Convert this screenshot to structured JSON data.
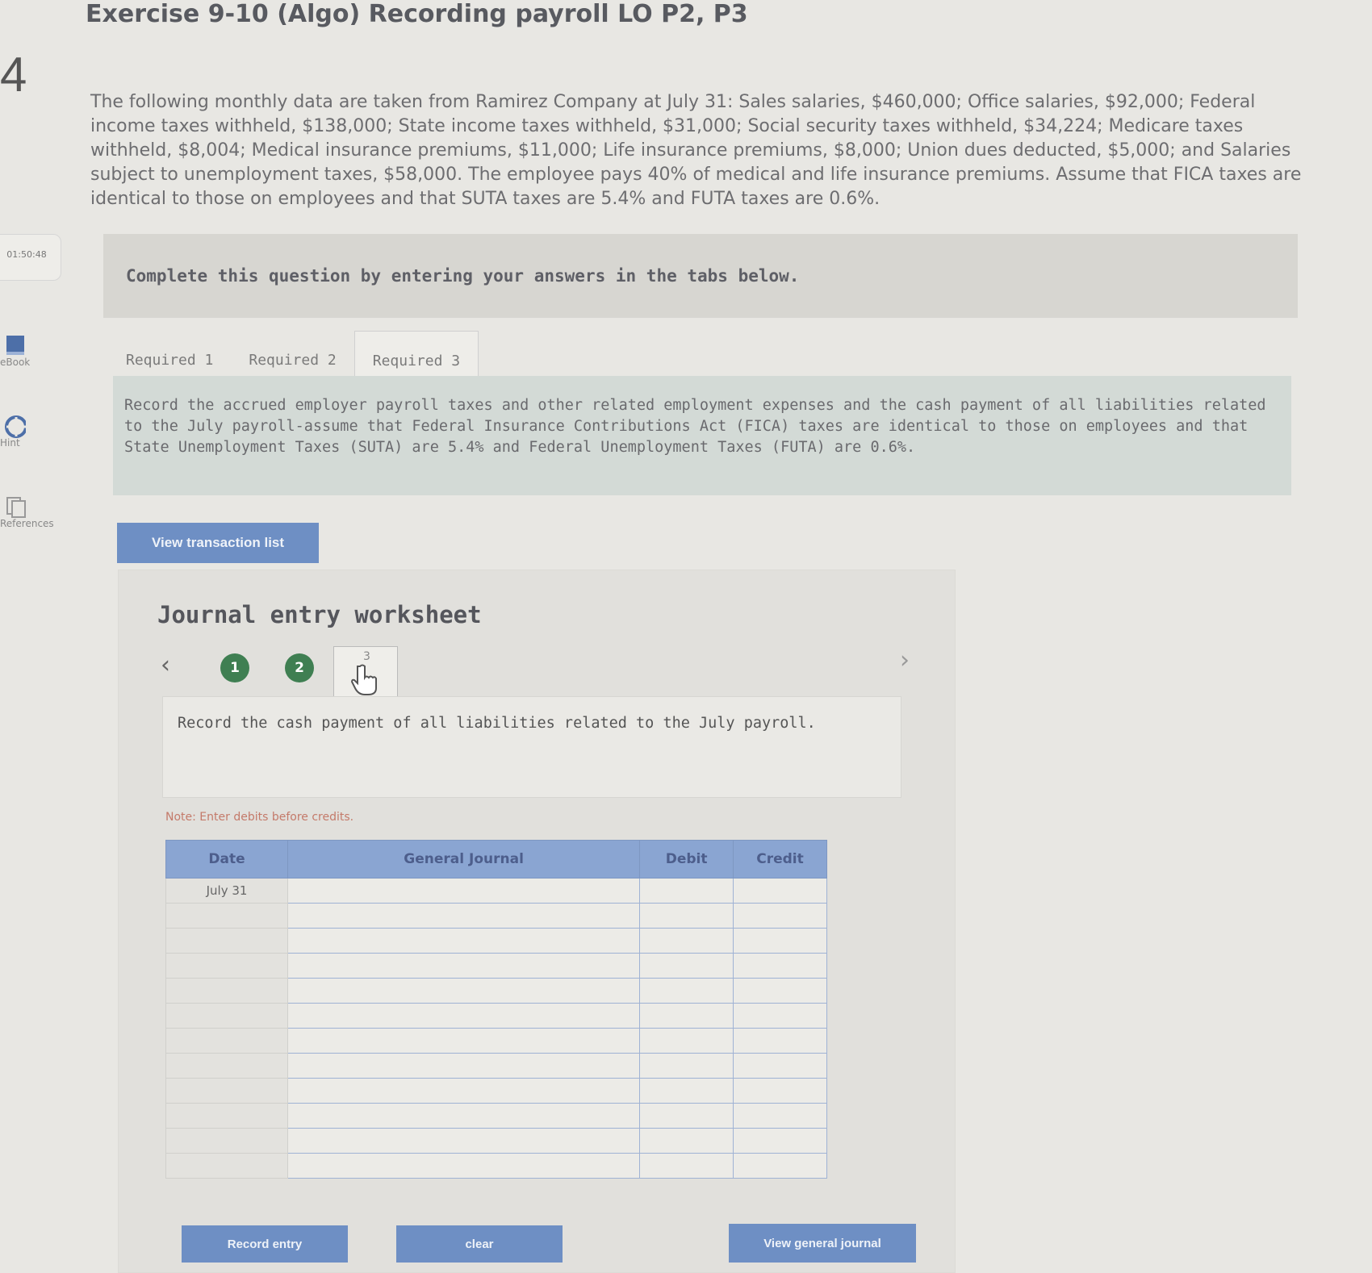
{
  "header": {
    "title": "Exercise 9-10 (Algo) Recording payroll LO P2, P3",
    "question_number": "4"
  },
  "problem_text": "The following monthly data are taken from Ramirez Company at July 31: Sales salaries, $460,000; Office salaries, $92,000; Federal income taxes withheld, $138,000; State income taxes withheld, $31,000; Social security taxes withheld, $34,224; Medicare taxes withheld, $8,004; Medical insurance premiums, $11,000; Life insurance premiums, $8,000; Union dues deducted, $5,000; and Salaries subject to unemployment taxes, $58,000. The employee pays 40% of medical and life insurance premiums. Assume that FICA taxes are identical to those on employees and that SUTA taxes are 5.4% and FUTA taxes are 0.6%.",
  "sidebar": {
    "timer": "01:50:48",
    "items": [
      {
        "label": "eBook"
      },
      {
        "label": "Hint"
      },
      {
        "label": "References"
      }
    ]
  },
  "banner": "Complete this question by entering your answers in the tabs below.",
  "tabs": [
    {
      "label": "Required 1"
    },
    {
      "label": "Required 2"
    },
    {
      "label": "Required 3"
    }
  ],
  "instructions": "Record the accrued employer payroll taxes and other related employment expenses and the cash payment of all liabilities related to the July payroll-assume that Federal Insurance Contributions Act (FICA) taxes are identical to those on employees and that State Unemployment Taxes (SUTA) are 5.4% and Federal Unemployment Taxes (FUTA) are 0.6%.",
  "view_transaction_button": "View transaction list",
  "worksheet": {
    "title": "Journal entry worksheet",
    "steps": [
      "1",
      "2",
      "3"
    ],
    "description": "Record the cash payment of all liabilities related to the July payroll.",
    "note": "Note: Enter debits before credits.",
    "columns": [
      "Date",
      "General Journal",
      "Debit",
      "Credit"
    ],
    "rows": [
      {
        "date": "July 31"
      },
      {
        "date": ""
      },
      {
        "date": ""
      },
      {
        "date": ""
      },
      {
        "date": ""
      },
      {
        "date": ""
      },
      {
        "date": ""
      },
      {
        "date": ""
      },
      {
        "date": ""
      },
      {
        "date": ""
      },
      {
        "date": ""
      },
      {
        "date": ""
      }
    ],
    "record_entry_button": "Record entry",
    "clear_button": "clear",
    "view_journal_button": "View general journal"
  }
}
